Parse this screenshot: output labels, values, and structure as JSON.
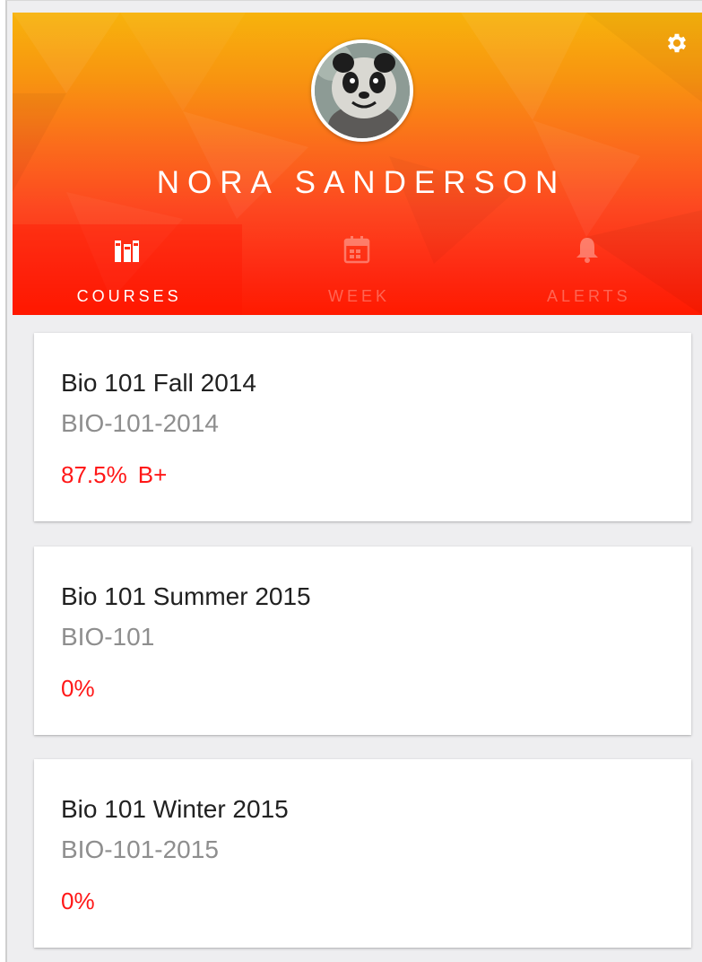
{
  "profile": {
    "name": "NORA SANDERSON",
    "avatar_icon": "avatar-panda-photo"
  },
  "header": {
    "settings_icon": "gear-icon",
    "gradient_top": "#f7b30c",
    "gradient_bottom": "#ff1a00"
  },
  "tabs": [
    {
      "label": "COURSES",
      "icon": "courses-icon",
      "active": true
    },
    {
      "label": "WEEK",
      "icon": "calendar-icon",
      "active": false
    },
    {
      "label": "ALERTS",
      "icon": "bell-icon",
      "active": false
    }
  ],
  "courses": [
    {
      "title": "Bio 101 Fall 2014",
      "code": "BIO-101-2014",
      "percent": "87.5%",
      "letter": "B+"
    },
    {
      "title": "Bio 101 Summer 2015",
      "code": "BIO-101",
      "percent": "0%",
      "letter": ""
    },
    {
      "title": "Bio 101 Winter 2015",
      "code": "BIO-101-2015",
      "percent": "0%",
      "letter": ""
    }
  ],
  "colors": {
    "grade_red": "#ff1717",
    "background": "#eeeef0"
  }
}
